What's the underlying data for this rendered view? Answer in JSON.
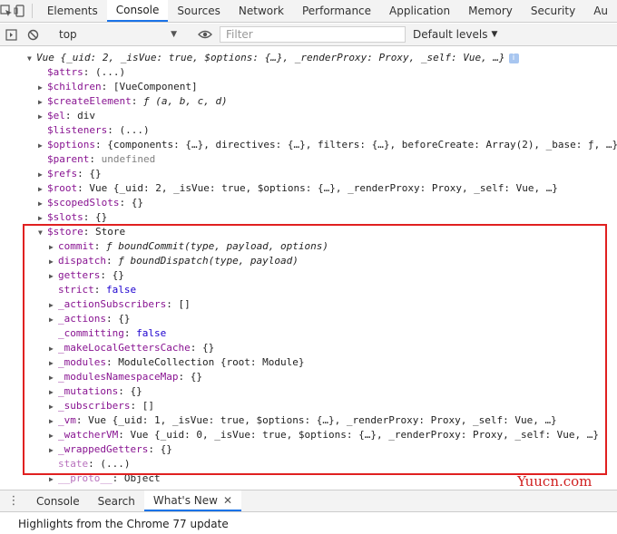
{
  "tabbar": {
    "inspect_icon": "inspect-icon",
    "device_icon": "device-toolbar-icon",
    "tabs": [
      "Elements",
      "Console",
      "Sources",
      "Network",
      "Performance",
      "Application",
      "Memory",
      "Security",
      "Au"
    ],
    "active_tab": "Console"
  },
  "toolbar": {
    "context": "top",
    "filter_placeholder": "Filter",
    "levels": "Default levels"
  },
  "console": {
    "header": "Vue {_uid: 2, _isVue: true, $options: {…}, _renderProxy: Proxy, _self: Vue, …}",
    "rows": [
      {
        "key": "$attrs",
        "value": "(...)",
        "expand": false
      },
      {
        "key": "$children",
        "value": "[VueComponent]",
        "expand": true
      },
      {
        "key": "$createElement",
        "value": "ƒ (a, b, c, d)",
        "expand": true,
        "italic": true
      },
      {
        "key": "$el",
        "value": "div",
        "expand": true
      },
      {
        "key": "$listeners",
        "value": "(...)",
        "expand": false
      },
      {
        "key": "$options",
        "value": "{components: {…}, directives: {…}, filters: {…}, beforeCreate: Array(2), _base: ƒ, …}",
        "expand": true
      },
      {
        "key": "$parent",
        "value": "undefined",
        "expand": false,
        "gray": true
      },
      {
        "key": "$refs",
        "value": "{}",
        "expand": true
      },
      {
        "key": "$root",
        "value": "Vue {_uid: 2, _isVue: true, $options: {…}, _renderProxy: Proxy, _self: Vue, …}",
        "expand": true
      },
      {
        "key": "$scopedSlots",
        "value": "{}",
        "expand": true
      },
      {
        "key": "$slots",
        "value": "{}",
        "expand": true
      }
    ],
    "store_row": {
      "key": "$store",
      "value": "Store"
    },
    "store_children": [
      {
        "key": "commit",
        "value": "ƒ boundCommit(type, payload, options)",
        "expand": true,
        "italic": true
      },
      {
        "key": "dispatch",
        "value": "ƒ boundDispatch(type, payload)",
        "expand": true,
        "italic": true
      },
      {
        "key": "getters",
        "value": "{}",
        "expand": true
      },
      {
        "key": "strict",
        "value": "false",
        "expand": false,
        "bool": true
      },
      {
        "key": "_actionSubscribers",
        "value": "[]",
        "expand": true
      },
      {
        "key": "_actions",
        "value": "{}",
        "expand": true
      },
      {
        "key": "_committing",
        "value": "false",
        "expand": false,
        "bool": true
      },
      {
        "key": "_makeLocalGettersCache",
        "value": "{}",
        "expand": true
      },
      {
        "key": "_modules",
        "value": "ModuleCollection {root: Module}",
        "expand": true
      },
      {
        "key": "_modulesNamespaceMap",
        "value": "{}",
        "expand": true
      },
      {
        "key": "_mutations",
        "value": "{}",
        "expand": true
      },
      {
        "key": "_subscribers",
        "value": "[]",
        "expand": true
      },
      {
        "key": "_vm",
        "value": "Vue {_uid: 1, _isVue: true, $options: {…}, _renderProxy: Proxy, _self: Vue, …}",
        "expand": true
      },
      {
        "key": "_watcherVM",
        "value": "Vue {_uid: 0, _isVue: true, $options: {…}, _renderProxy: Proxy, _self: Vue, …}",
        "expand": true
      },
      {
        "key": "_wrappedGetters",
        "value": "{}",
        "expand": true
      },
      {
        "key": "state",
        "value": "(...)",
        "expand": false,
        "dim": true
      },
      {
        "key": "__proto__",
        "value": "Object",
        "expand": true,
        "dim": true
      }
    ]
  },
  "watermark": "Yuucn.com",
  "drawer": {
    "tabs": [
      "Console",
      "Search",
      "What's New"
    ],
    "active_tab": "What's New",
    "body": "Highlights from the Chrome 77 update"
  },
  "colors": {
    "highlight": "#e02020",
    "accent": "#1a73e8",
    "key": "#881391",
    "bool": "#1c00cf"
  }
}
